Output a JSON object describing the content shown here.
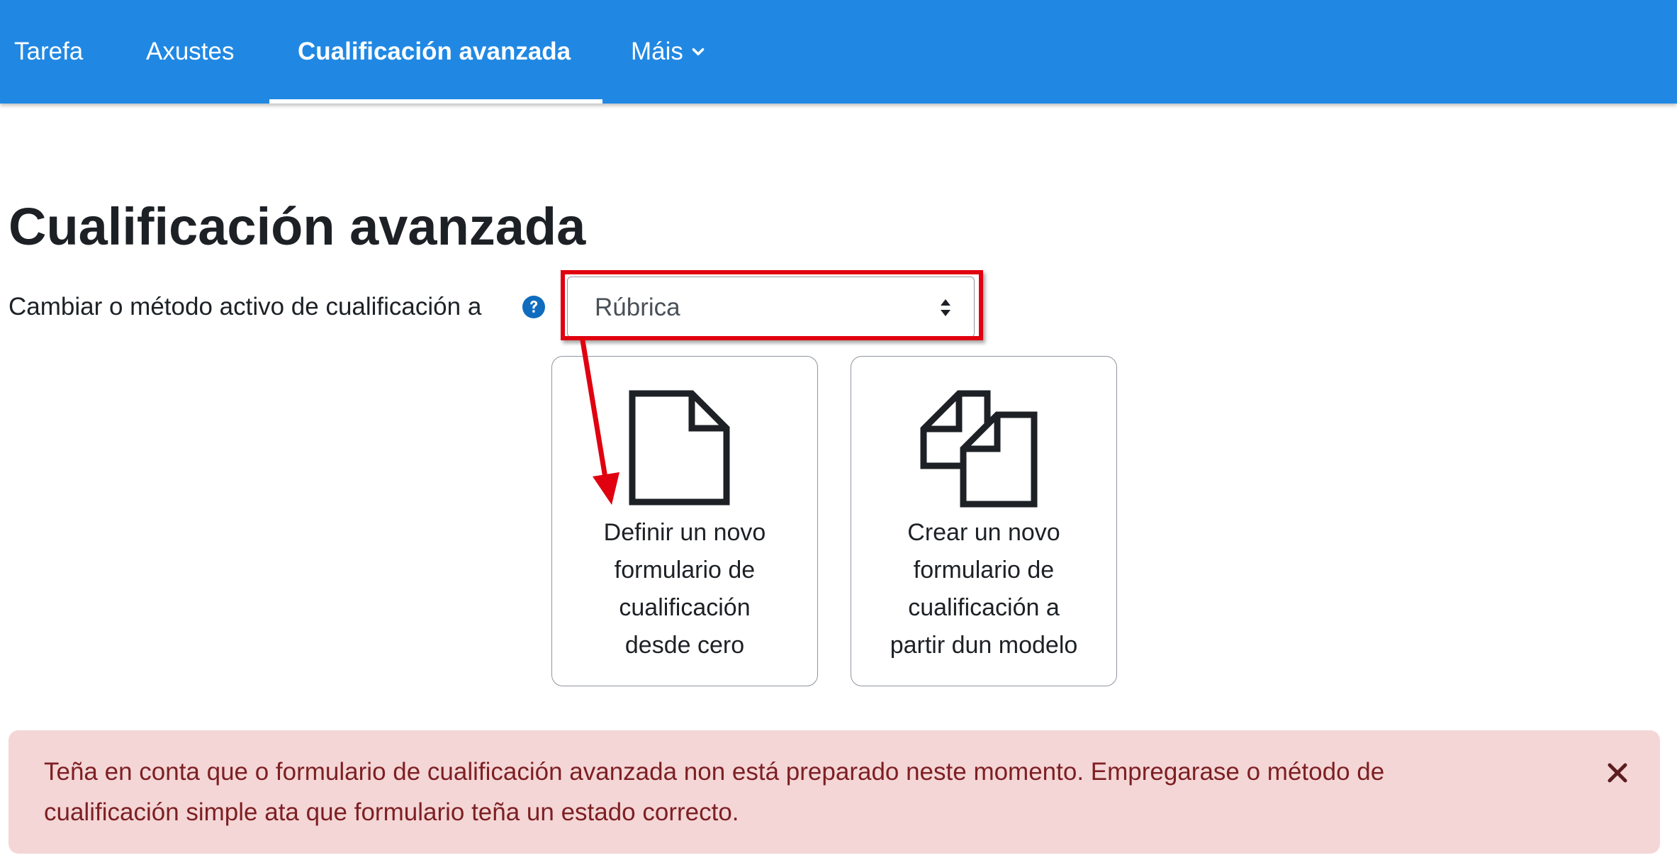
{
  "nav": {
    "items": [
      {
        "label": "Tarefa",
        "active": false
      },
      {
        "label": "Axustes",
        "active": false
      },
      {
        "label": "Cualificación avanzada",
        "active": true
      },
      {
        "label": "Máis",
        "active": false
      }
    ],
    "more_icon": "chevron-down-icon",
    "background_color": "#2088e3"
  },
  "page": {
    "title": "Cualificación avanzada"
  },
  "method": {
    "label": "Cambiar o método activo de cualificación a",
    "help_icon": "question-circle-icon",
    "selected": "Rúbrica",
    "highlight_color": "#e0000f"
  },
  "cards": [
    {
      "icon": "file-icon",
      "lines": [
        "Definir un novo",
        "formulario de",
        "cualificación",
        "desde cero"
      ]
    },
    {
      "icon": "copy-icon",
      "lines": [
        "Crear un novo",
        "formulario de",
        "cualificación a",
        "partir dun modelo"
      ]
    }
  ],
  "alert": {
    "lines": [
      "Teña en conta que o formulario de cualificación avanzada non está preparado neste momento. Empregarase o método de",
      "cualificación simple ata que formulario teña un estado correcto."
    ],
    "close_icon": "close-icon",
    "background_color": "#f4d6d6"
  }
}
